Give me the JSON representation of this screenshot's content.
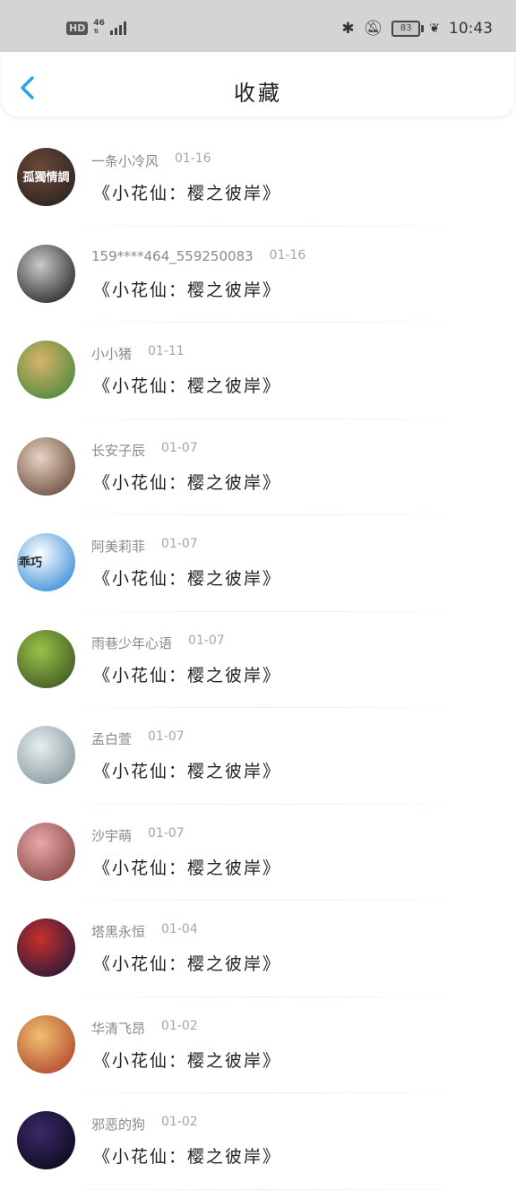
{
  "status_bar": {
    "hd": "HD",
    "net": "46",
    "battery": "83",
    "time": "10:43"
  },
  "header": {
    "title": "收藏",
    "back_icon": "chevron-left-icon",
    "accent": "#2a9fe3"
  },
  "items": [
    {
      "user": "一条小冷风",
      "date": "01-16",
      "book": "《小花仙：樱之彼岸》",
      "avatar_text": "孤獨情調",
      "avatar_colors": [
        "#6b4a3a",
        "#2e2320"
      ]
    },
    {
      "user": "159****464_559250083",
      "date": "01-16",
      "book": "《小花仙：樱之彼岸》",
      "avatar_text": "",
      "avatar_colors": [
        "#c9c9c9",
        "#2b2b2b"
      ]
    },
    {
      "user": "小小猪",
      "date": "01-11",
      "book": "《小花仙：樱之彼岸》",
      "avatar_text": "",
      "avatar_colors": [
        "#d8b36a",
        "#4f8a3c"
      ]
    },
    {
      "user": "长安子辰",
      "date": "01-07",
      "book": "《小花仙：樱之彼岸》",
      "avatar_text": "",
      "avatar_colors": [
        "#e7d4c4",
        "#6e4e40"
      ]
    },
    {
      "user": "阿美莉菲",
      "date": "01-07",
      "book": "《小花仙：樱之彼岸》",
      "avatar_text": "乖巧",
      "avatar_colors": [
        "#ffffff",
        "#3a8fd8"
      ]
    },
    {
      "user": "雨巷少年心语",
      "date": "01-07",
      "book": "《小花仙：樱之彼岸》",
      "avatar_text": "",
      "avatar_colors": [
        "#9bc24a",
        "#3f5a22"
      ]
    },
    {
      "user": "孟白萱",
      "date": "01-07",
      "book": "《小花仙：樱之彼岸》",
      "avatar_text": "",
      "avatar_colors": [
        "#e6eef0",
        "#8a9aa0"
      ]
    },
    {
      "user": "沙宇萌",
      "date": "01-07",
      "book": "《小花仙：樱之彼岸》",
      "avatar_text": "",
      "avatar_colors": [
        "#e8a8a8",
        "#8a4a4a"
      ]
    },
    {
      "user": "塔黑永恒",
      "date": "01-04",
      "book": "《小花仙：樱之彼岸》",
      "avatar_text": "",
      "avatar_colors": [
        "#c8302c",
        "#2a1a3a"
      ]
    },
    {
      "user": "华清飞昂",
      "date": "01-02",
      "book": "《小花仙：樱之彼岸》",
      "avatar_text": "",
      "avatar_colors": [
        "#f2c070",
        "#b04a30"
      ]
    },
    {
      "user": "邪恶的狗",
      "date": "01-02",
      "book": "《小花仙：樱之彼岸》",
      "avatar_text": "",
      "avatar_colors": [
        "#3a2a6a",
        "#0e0a1e"
      ]
    }
  ]
}
